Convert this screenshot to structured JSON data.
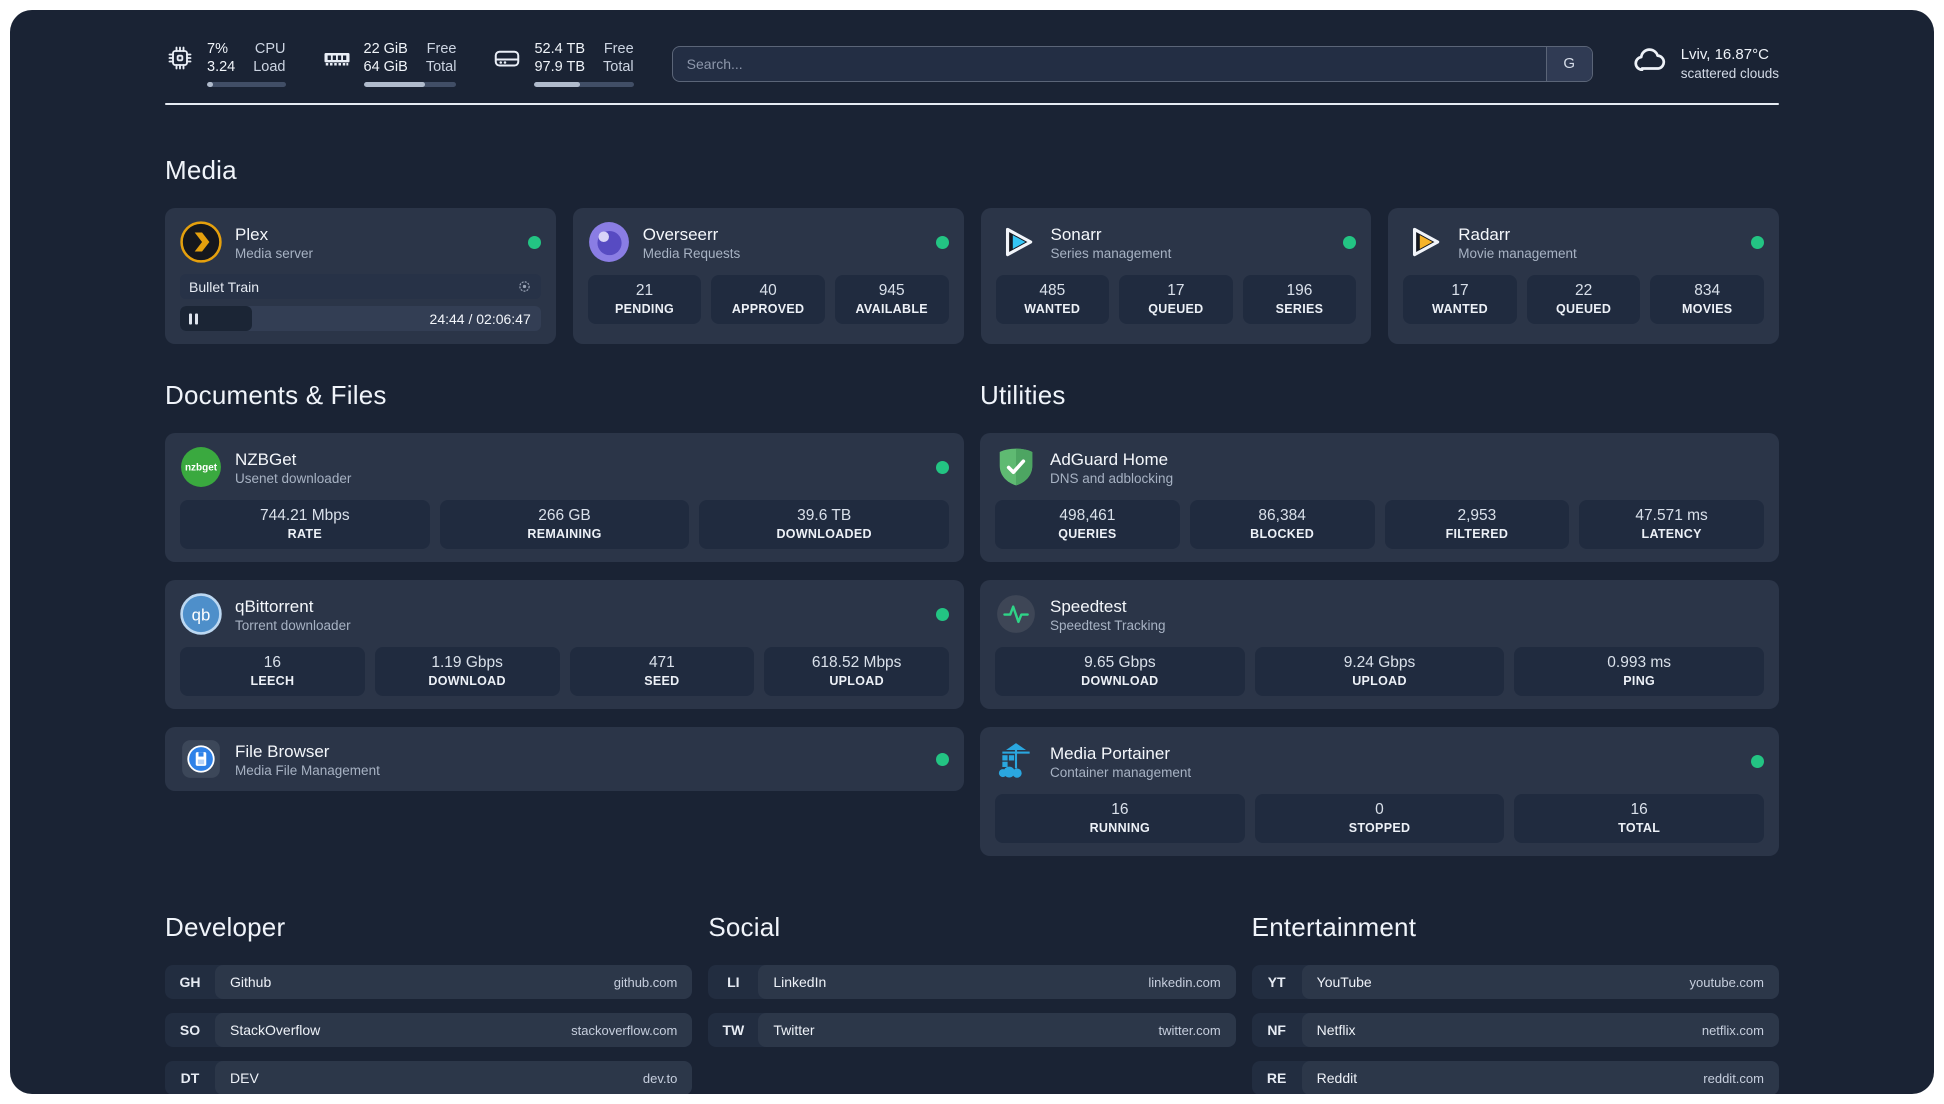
{
  "topbar": {
    "cpu": {
      "value_top": "7%",
      "value_bottom": "3.24",
      "label_top": "CPU",
      "label_bottom": "Load",
      "progress": 8
    },
    "memory": {
      "value_top": "22 GiB",
      "value_bottom": "64 GiB",
      "label_top": "Free",
      "label_bottom": "Total",
      "progress": 66
    },
    "disk": {
      "value_top": "52.4 TB",
      "value_bottom": "97.9 TB",
      "label_top": "Free",
      "label_bottom": "Total",
      "progress": 46
    },
    "search": {
      "placeholder": "Search...",
      "engine_badge": "G"
    },
    "weather": {
      "location_temp": "Lviv, 16.87°C",
      "condition": "scattered clouds"
    }
  },
  "sections": {
    "media": "Media",
    "documents": "Documents & Files",
    "utilities": "Utilities",
    "developer": "Developer",
    "social": "Social",
    "entertainment": "Entertainment"
  },
  "services": {
    "plex": {
      "title": "Plex",
      "subtitle": "Media server",
      "now_playing": "Bullet Train",
      "time": "24:44 / 02:06:47",
      "progress": 20
    },
    "overseerr": {
      "title": "Overseerr",
      "subtitle": "Media Requests",
      "stats": [
        {
          "value": "21",
          "label": "PENDING"
        },
        {
          "value": "40",
          "label": "APPROVED"
        },
        {
          "value": "945",
          "label": "AVAILABLE"
        }
      ]
    },
    "sonarr": {
      "title": "Sonarr",
      "subtitle": "Series management",
      "stats": [
        {
          "value": "485",
          "label": "WANTED"
        },
        {
          "value": "17",
          "label": "QUEUED"
        },
        {
          "value": "196",
          "label": "SERIES"
        }
      ]
    },
    "radarr": {
      "title": "Radarr",
      "subtitle": "Movie management",
      "stats": [
        {
          "value": "17",
          "label": "WANTED"
        },
        {
          "value": "22",
          "label": "QUEUED"
        },
        {
          "value": "834",
          "label": "MOVIES"
        }
      ]
    },
    "nzbget": {
      "title": "NZBGet",
      "subtitle": "Usenet downloader",
      "stats": [
        {
          "value": "744.21 Mbps",
          "label": "RATE"
        },
        {
          "value": "266 GB",
          "label": "REMAINING"
        },
        {
          "value": "39.6 TB",
          "label": "DOWNLOADED"
        }
      ]
    },
    "qbittorrent": {
      "title": "qBittorrent",
      "subtitle": "Torrent downloader",
      "stats": [
        {
          "value": "16",
          "label": "LEECH"
        },
        {
          "value": "1.19 Gbps",
          "label": "DOWNLOAD"
        },
        {
          "value": "471",
          "label": "SEED"
        },
        {
          "value": "618.52 Mbps",
          "label": "UPLOAD"
        }
      ]
    },
    "filebrowser": {
      "title": "File Browser",
      "subtitle": "Media File Management"
    },
    "adguard": {
      "title": "AdGuard Home",
      "subtitle": "DNS and adblocking",
      "stats": [
        {
          "value": "498,461",
          "label": "QUERIES"
        },
        {
          "value": "86,384",
          "label": "BLOCKED"
        },
        {
          "value": "2,953",
          "label": "FILTERED"
        },
        {
          "value": "47.571 ms",
          "label": "LATENCY"
        }
      ]
    },
    "speedtest": {
      "title": "Speedtest",
      "subtitle": "Speedtest Tracking",
      "stats": [
        {
          "value": "9.65 Gbps",
          "label": "DOWNLOAD"
        },
        {
          "value": "9.24 Gbps",
          "label": "UPLOAD"
        },
        {
          "value": "0.993 ms",
          "label": "PING"
        }
      ]
    },
    "portainer": {
      "title": "Media Portainer",
      "subtitle": "Container management",
      "stats": [
        {
          "value": "16",
          "label": "RUNNING"
        },
        {
          "value": "0",
          "label": "STOPPED"
        },
        {
          "value": "16",
          "label": "TOTAL"
        }
      ]
    }
  },
  "links": {
    "developer": [
      {
        "abbr": "GH",
        "name": "Github",
        "url": "github.com"
      },
      {
        "abbr": "SO",
        "name": "StackOverflow",
        "url": "stackoverflow.com"
      },
      {
        "abbr": "DT",
        "name": "DEV",
        "url": "dev.to"
      }
    ],
    "social": [
      {
        "abbr": "LI",
        "name": "LinkedIn",
        "url": "linkedin.com"
      },
      {
        "abbr": "TW",
        "name": "Twitter",
        "url": "twitter.com"
      }
    ],
    "entertainment": [
      {
        "abbr": "YT",
        "name": "YouTube",
        "url": "youtube.com"
      },
      {
        "abbr": "NF",
        "name": "Netflix",
        "url": "netflix.com"
      },
      {
        "abbr": "RE",
        "name": "Reddit",
        "url": "reddit.com"
      }
    ]
  },
  "colors": {
    "status_green": "#23c483",
    "plex_amber": "#e5a00d",
    "sonarr_blue": "#35c5f4",
    "radarr_yellow": "#f7b42a",
    "nzbget_green": "#3aa93f",
    "qbittorrent_blue": "#4e8fca",
    "adguard_green": "#5fba72",
    "portainer_blue": "#2aa7e0",
    "overseerr_purple": "#8a7de4"
  }
}
